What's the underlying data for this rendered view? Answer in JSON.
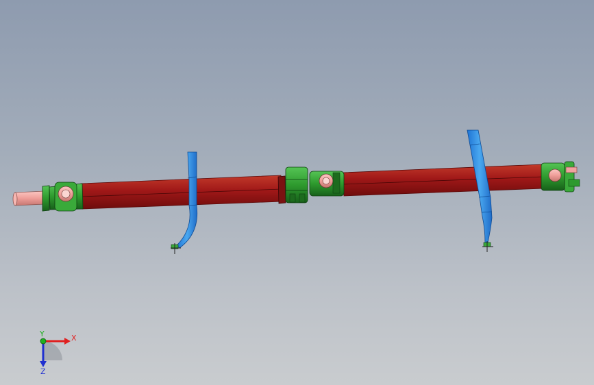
{
  "viewport": {
    "background_top": "#8e9baf",
    "background_bottom": "#c9cccf"
  },
  "model": {
    "components": [
      {
        "name": "drive-shaft-tube",
        "color": "#a01818"
      },
      {
        "name": "universal-joint",
        "color": "#2e9a2e"
      },
      {
        "name": "slip-yoke",
        "color": "#f0a3a0"
      },
      {
        "name": "support-bracket",
        "color": "#3a8fe0"
      }
    ]
  },
  "triad": {
    "x_label": "X",
    "y_label": "Y",
    "z_label": "Z",
    "x_color": "#e02020",
    "y_color": "#20b020",
    "z_color": "#2030d0"
  }
}
